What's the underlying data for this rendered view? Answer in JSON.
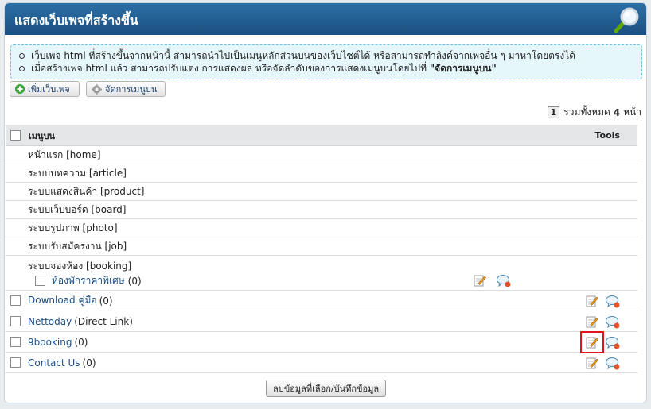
{
  "header": {
    "title": "แสดงเว็บเพจที่สร้างขึ้น"
  },
  "info": {
    "line1": "เว็บเพจ html ที่สร้างขึ้นจากหน้านี้ สามารถนำไปเป็นเมนูหลักส่วนบนของเว็บไซต์ได้ หรือสามารถทำลิงค์จากเพจอื่น ๆ มาหาโดยตรงได้",
    "line2_prefix": "เมื่อสร้างเพจ html แล้ว สามารถปรับแต่ง การแสดงผล หรือจัดลำดับของการแสดงเมนูบนโดยไปที่ ",
    "line2_bold": "\"จัดการเมนูบน\""
  },
  "toolbar": {
    "add_label": "เพิ่มเว็บเพจ",
    "manage_label": "จัดการเมนูบน"
  },
  "pager": {
    "current": "1",
    "prefix": "รวมทั้งหมด",
    "total": "4",
    "suffix": "หน้า"
  },
  "table": {
    "col_menu": "เมนูบน",
    "col_tools": "Tools"
  },
  "system_items": [
    "หน้าแรก [home]",
    "ระบบบทความ [article]",
    "ระบบแสดงสินค้า [product]",
    "ระบบเว็บบอร์ด [board]",
    "ระบบรูปภาพ [photo]",
    "ระบบรับสมัครงาน [job]"
  ],
  "booking": {
    "label": "ระบบจองห้อง [booking]",
    "child_link": "ห้องพักราคาพิเศษ",
    "child_count": "(0)"
  },
  "pages": [
    {
      "link": "Download คู่มือ",
      "extra": "(0)"
    },
    {
      "link": "Nettoday",
      "extra": "(Direct Link)"
    },
    {
      "link": "9booking",
      "extra": "(0)"
    },
    {
      "link": "Contact Us",
      "extra": "(0)"
    }
  ],
  "footer": {
    "save_label": "ลบข้อมูลที่เลือก/บันทึกข้อมูล"
  },
  "colors": {
    "header": "#1b4f80",
    "link": "#1c4f86",
    "highlight": "#e0141e"
  }
}
